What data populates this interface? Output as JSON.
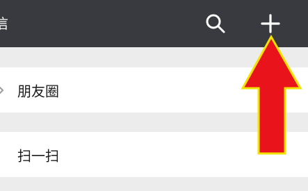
{
  "header": {
    "title_fragment": "信",
    "search_icon": "search-icon",
    "add_icon": "plus-icon"
  },
  "menu": {
    "items": [
      {
        "label": "朋友圈",
        "icon": "moments-icon"
      },
      {
        "label": "扫一扫",
        "icon": "scan-icon"
      }
    ]
  },
  "colors": {
    "top_bar": "#393a3f",
    "separator": "#ececec",
    "arrow_fill": "#e8131b",
    "arrow_outline": "#f2e200"
  },
  "annotation": {
    "type": "arrow",
    "direction": "up",
    "target": "plus-button"
  }
}
